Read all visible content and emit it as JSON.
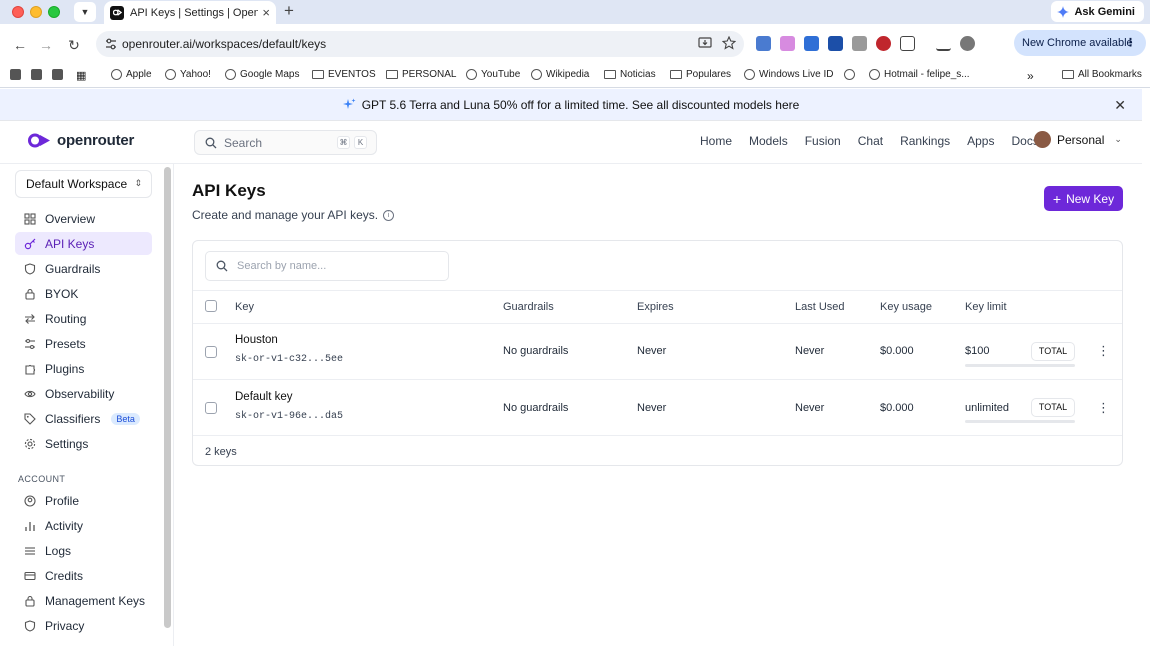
{
  "browser": {
    "tab_title": "API Keys | Settings | OpenRou",
    "url": "openrouter.ai/workspaces/default/keys",
    "gemini_label": "Ask Gemini",
    "update_label": "New Chrome available",
    "bookmarks": [
      "Apple",
      "Yahoo!",
      "Google Maps",
      "EVENTOS",
      "PERSONAL",
      "YouTube",
      "Wikipedia",
      "Noticias",
      "Populares",
      "Windows Live ID",
      "Hotmail - felipe_s...",
      "All Bookmarks"
    ]
  },
  "banner": {
    "text": "GPT 5.6 Terra and Luna 50% off for a limited time. See all discounted models here"
  },
  "header": {
    "logo_text": "openrouter",
    "search_placeholder": "Search",
    "kbd1": "⌘",
    "kbd2": "K",
    "nav": [
      "Home",
      "Models",
      "Fusion",
      "Chat",
      "Rankings",
      "Apps",
      "Docs"
    ],
    "profile_label": "Personal"
  },
  "sidebar": {
    "workspace": "Default Workspace",
    "items": [
      "Overview",
      "API Keys",
      "Guardrails",
      "BYOK",
      "Routing",
      "Presets",
      "Plugins",
      "Observability",
      "Classifiers",
      "Settings"
    ],
    "beta_label": "Beta",
    "account_heading": "ACCOUNT",
    "account_items": [
      "Profile",
      "Activity",
      "Logs",
      "Credits",
      "Management Keys",
      "Privacy"
    ]
  },
  "main": {
    "title": "API Keys",
    "subtitle": "Create and manage your API keys.",
    "new_key_label": "New Key",
    "search_placeholder": "Search by name...",
    "columns": [
      "Key",
      "Guardrails",
      "Expires",
      "Last Used",
      "Key usage",
      "Key limit"
    ],
    "rows": [
      {
        "name": "Houston",
        "key": "sk-or-v1-c32...5ee",
        "guardrails": "No guardrails",
        "expires": "Never",
        "last_used": "Never",
        "usage": "$0.000",
        "limit": "$100",
        "limit_type": "TOTAL"
      },
      {
        "name": "Default key",
        "key": "sk-or-v1-96e...da5",
        "guardrails": "No guardrails",
        "expires": "Never",
        "last_used": "Never",
        "usage": "$0.000",
        "limit": "unlimited",
        "limit_type": "TOTAL"
      }
    ],
    "footer_count": "2 keys"
  },
  "colors": {
    "accent": "#6d28d9",
    "active_bg": "#ede9fe",
    "banner_bg": "#edf2ff"
  }
}
